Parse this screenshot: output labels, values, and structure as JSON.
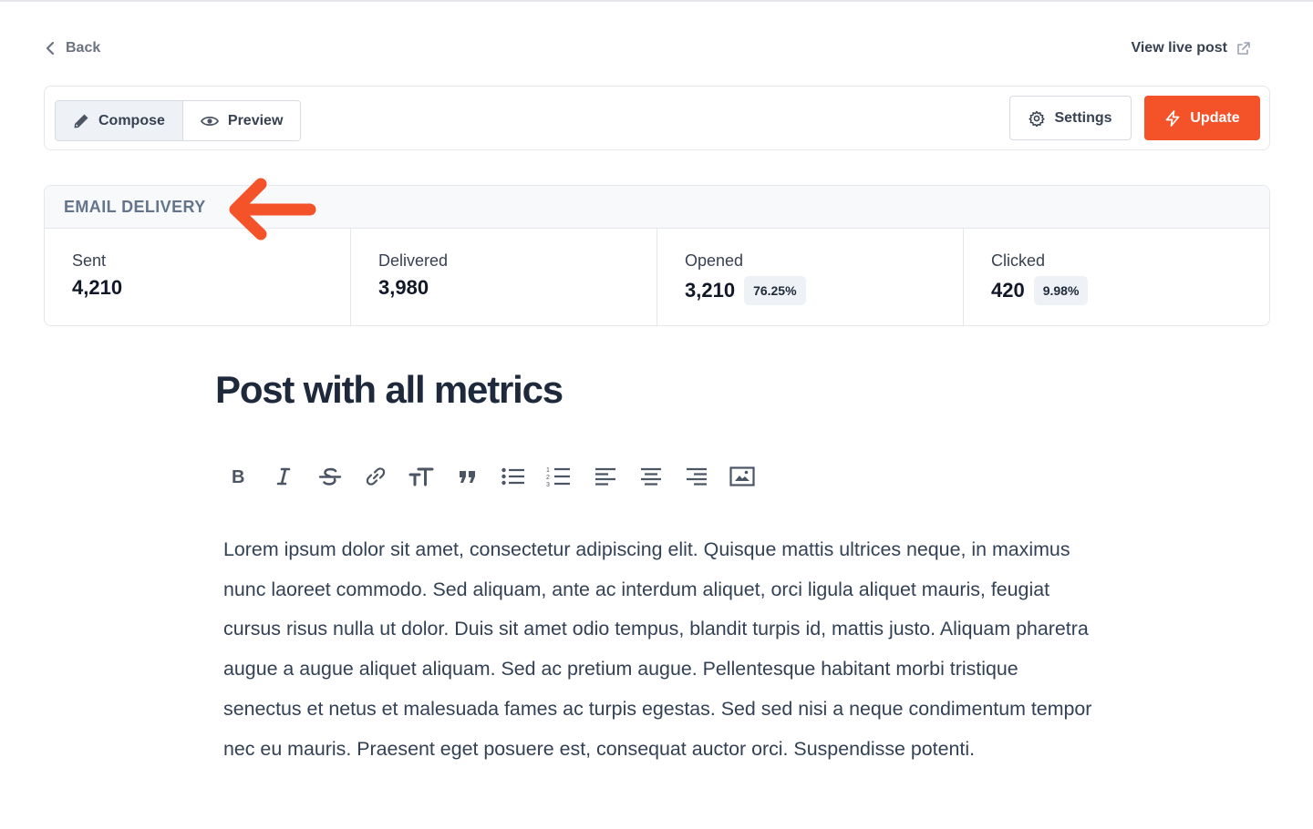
{
  "nav": {
    "back_label": "Back",
    "view_live_label": "View live post"
  },
  "toolbar": {
    "tabs": [
      {
        "label": "Compose",
        "icon": "pencil-icon",
        "active": true
      },
      {
        "label": "Preview",
        "icon": "eye-icon",
        "active": false
      }
    ],
    "settings_label": "Settings",
    "update_label": "Update"
  },
  "delivery": {
    "title": "EMAIL DELIVERY",
    "metrics": [
      {
        "label": "Sent",
        "value": "4,210",
        "percent": ""
      },
      {
        "label": "Delivered",
        "value": "3,980",
        "percent": ""
      },
      {
        "label": "Opened",
        "value": "3,210",
        "percent": "76.25%"
      },
      {
        "label": "Clicked",
        "value": "420",
        "percent": "9.98%"
      }
    ]
  },
  "post": {
    "title": "Post with all metrics",
    "body": "Lorem ipsum dolor sit amet, consectetur adipiscing elit. Quisque mattis ultrices neque, in maximus nunc laoreet commodo. Sed aliquam, ante ac interdum aliquet, orci ligula aliquet mauris, feugiat cursus risus nulla ut dolor. Duis sit amet odio tempus, blandit turpis id, mattis justo. Aliquam pharetra augue a augue aliquet aliquam. Sed ac pretium augue. Pellentesque habitant morbi tristique senectus et netus et malesuada fames ac turpis egestas. Sed sed nisi a neque condimentum tempor nec eu mauris. Praesent eget posuere est, consequat auctor orci. Suspendisse potenti."
  },
  "editor_tools": [
    "bold-icon",
    "italic-icon",
    "strikethrough-icon",
    "link-icon",
    "text-size-icon",
    "quote-icon",
    "bullet-list-icon",
    "numbered-list-icon",
    "align-left-icon",
    "align-center-icon",
    "align-right-icon",
    "image-icon"
  ],
  "colors": {
    "accent": "#f4532a",
    "muted_text": "#64748b",
    "badge_bg": "#eef2f7"
  }
}
